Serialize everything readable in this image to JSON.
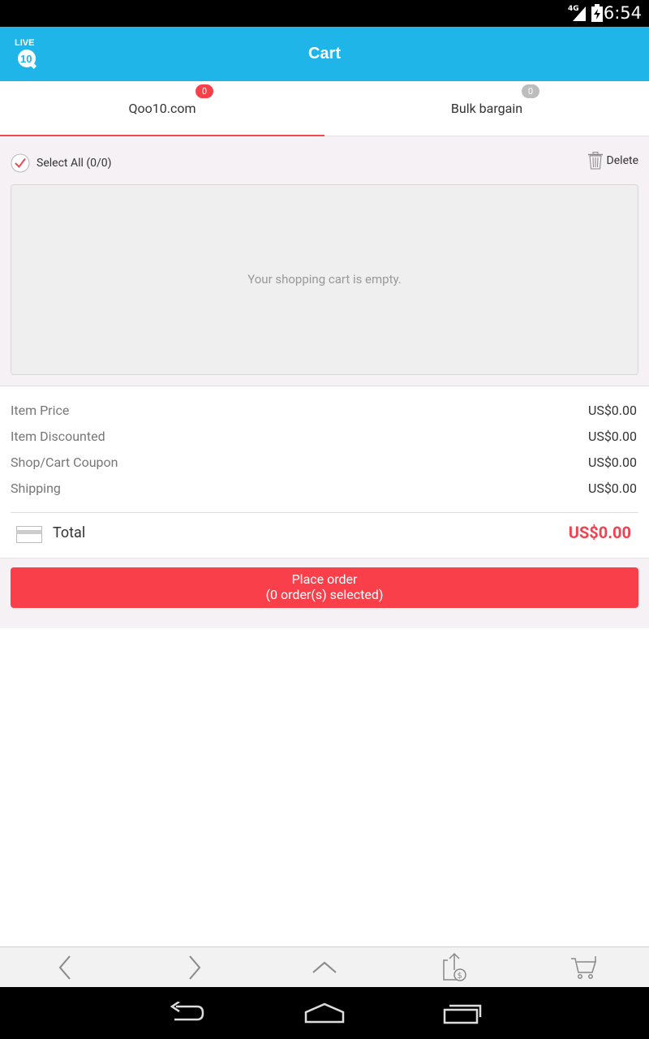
{
  "status_bar": {
    "time": "6:54",
    "network": "4G"
  },
  "header": {
    "logo_line1": "LIVE",
    "logo_line2": "10",
    "title": "Cart"
  },
  "tabs": [
    {
      "label": "Qoo10.com",
      "badge": "0",
      "active": true,
      "badge_color": "#f9404a"
    },
    {
      "label": "Bulk bargain",
      "badge": "0",
      "active": false,
      "badge_color": "#bdbdbd"
    }
  ],
  "cart": {
    "select_all_label": "Select All (0/0)",
    "delete_label": "Delete",
    "empty_message": "Your shopping cart is empty."
  },
  "summary": {
    "rows": [
      {
        "label": "Item Price",
        "value": "US$0.00"
      },
      {
        "label": "Item Discounted",
        "value": "US$0.00"
      },
      {
        "label": "Shop/Cart Coupon",
        "value": "US$0.00"
      },
      {
        "label": "Shipping",
        "value": "US$0.00"
      }
    ],
    "total_label": "Total",
    "total_value": "US$0.00"
  },
  "order": {
    "line1": "Place order",
    "line2": "(0 order(s) selected)"
  },
  "toolbar": [
    "back-icon",
    "forward-icon",
    "scroll-top-icon",
    "share-price-icon",
    "cart-icon"
  ],
  "colors": {
    "header": "#1fb5e8",
    "accent": "#f9404a",
    "total": "#f0434f"
  }
}
